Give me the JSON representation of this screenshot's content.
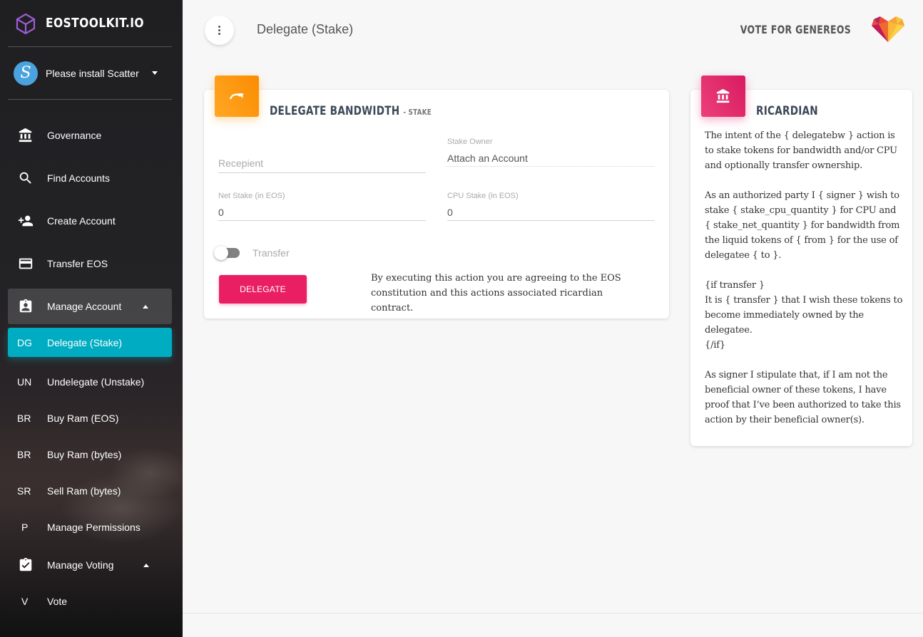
{
  "brand": {
    "name": "EOSTOOLKIT.IO"
  },
  "user": {
    "label": "Please install Scatter"
  },
  "nav": {
    "items": [
      {
        "label": "Governance"
      },
      {
        "label": "Find Accounts"
      },
      {
        "label": "Create Account"
      },
      {
        "label": "Transfer EOS"
      },
      {
        "label": "Manage Account"
      }
    ],
    "manage_account_sub": [
      {
        "abbr": "DG",
        "label": "Delegate (Stake)"
      },
      {
        "abbr": "UN",
        "label": "Undelegate (Unstake)"
      },
      {
        "abbr": "BR",
        "label": "Buy Ram (EOS)"
      },
      {
        "abbr": "BR",
        "label": "Buy Ram (bytes)"
      },
      {
        "abbr": "SR",
        "label": "Sell Ram (bytes)"
      },
      {
        "abbr": "P",
        "label": "Manage Permissions"
      }
    ],
    "voting": {
      "label": "Manage Voting"
    },
    "voting_sub": [
      {
        "abbr": "V",
        "label": "Vote"
      }
    ]
  },
  "topbar": {
    "title": "Delegate (Stake)",
    "vote_link": "VOTE FOR GENEREOS"
  },
  "delegate_card": {
    "title": "DELEGATE BANDWIDTH",
    "subtitle": "- STAKE",
    "recipient": {
      "placeholder": "Recepient",
      "value": ""
    },
    "stake_owner": {
      "label": "Stake Owner",
      "value": "Attach an Account"
    },
    "net_stake": {
      "label": "Net Stake (in EOS)",
      "value": "0"
    },
    "cpu_stake": {
      "label": "CPU Stake (in EOS)",
      "value": "0"
    },
    "transfer_toggle": {
      "label": "Transfer",
      "checked": false
    },
    "delegate_button": "DELEGATE",
    "agreement": "By executing this action you are agreeing to the EOS constitution and this actions associated ricardian contract."
  },
  "ricardian_card": {
    "title": "RICARDIAN",
    "text": "The intent of the { delegatebw } action is to stake tokens for bandwidth and/or CPU and optionally transfer ownership.\n\nAs an authorized party I { signer } wish to stake { stake_cpu_quantity } for CPU and { stake_net_quantity } for bandwidth from the liquid tokens of { from } for the use of delegatee { to }.\n\n{if transfer }\nIt is { transfer } that I wish these tokens to become immediately owned by the delegatee.\n{/if}\n\nAs signer I stipulate that, if I am not the beneficial owner of these tokens, I have proof that I’ve been authorized to take this action by their beneficial owner(s)."
  },
  "colors": {
    "active_item": "#00acc1",
    "delegate_icon": "#ff9800",
    "ricardian_icon": "#e91e63",
    "delegate_button": "#e91e63"
  },
  "icons": {
    "brand": "cube-icon",
    "governance": "bank-icon",
    "find_accounts": "search-icon",
    "create_account": "person-add-icon",
    "transfer_eos": "credit-card-icon",
    "manage_account": "assignment-ind-icon",
    "manage_voting": "assignment-turned-in-icon",
    "delegate_card": "redo-arrow-icon",
    "ricardian_card": "bank-icon",
    "vote_logo": "heart-logo-icon"
  }
}
